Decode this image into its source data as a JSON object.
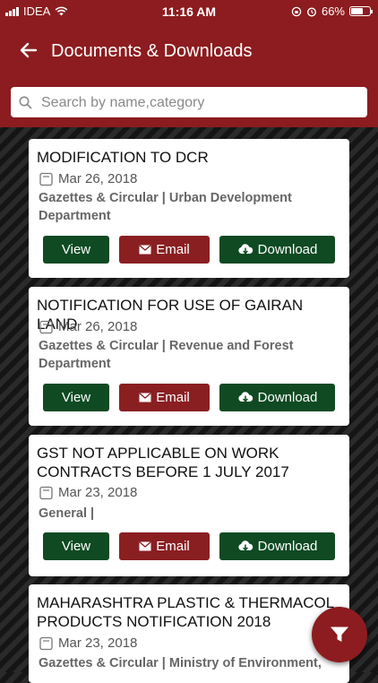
{
  "status_bar": {
    "carrier": "IDEA",
    "time": "11:16 AM",
    "battery": "66%",
    "battery_level": 0.66
  },
  "header": {
    "title": "Documents & Downloads",
    "back_icon": "back-arrow-icon"
  },
  "search": {
    "placeholder": "Search by name,category",
    "value": ""
  },
  "actions": {
    "view": "View",
    "email": "Email",
    "download": "Download"
  },
  "documents": [
    {
      "title": "MODIFICATION TO DCR",
      "date": "Mar 26, 2018",
      "category": "Gazettes & Circular | Urban Development Department"
    },
    {
      "title": "NOTIFICATION FOR USE OF GAIRAN LAND",
      "date": "Mar 26, 2018",
      "category": "Gazettes & Circular | Revenue and Forest Department"
    },
    {
      "title": "GST NOT APPLICABLE ON WORK CONTRACTS BEFORE 1 JULY 2017",
      "date": "Mar 23, 2018",
      "category": "General |"
    },
    {
      "title": "MAHARASHTRA PLASTIC & THERMACOL PRODUCTS NOTIFICATION 2018",
      "date": "Mar 23, 2018",
      "category": "Gazettes & Circular | Ministry of Environment,"
    }
  ],
  "colors": {
    "brand": "#8c1c1f",
    "button_green": "#0f4a23",
    "button_red": "#8a1f22"
  },
  "fab_icon": "filter-icon"
}
